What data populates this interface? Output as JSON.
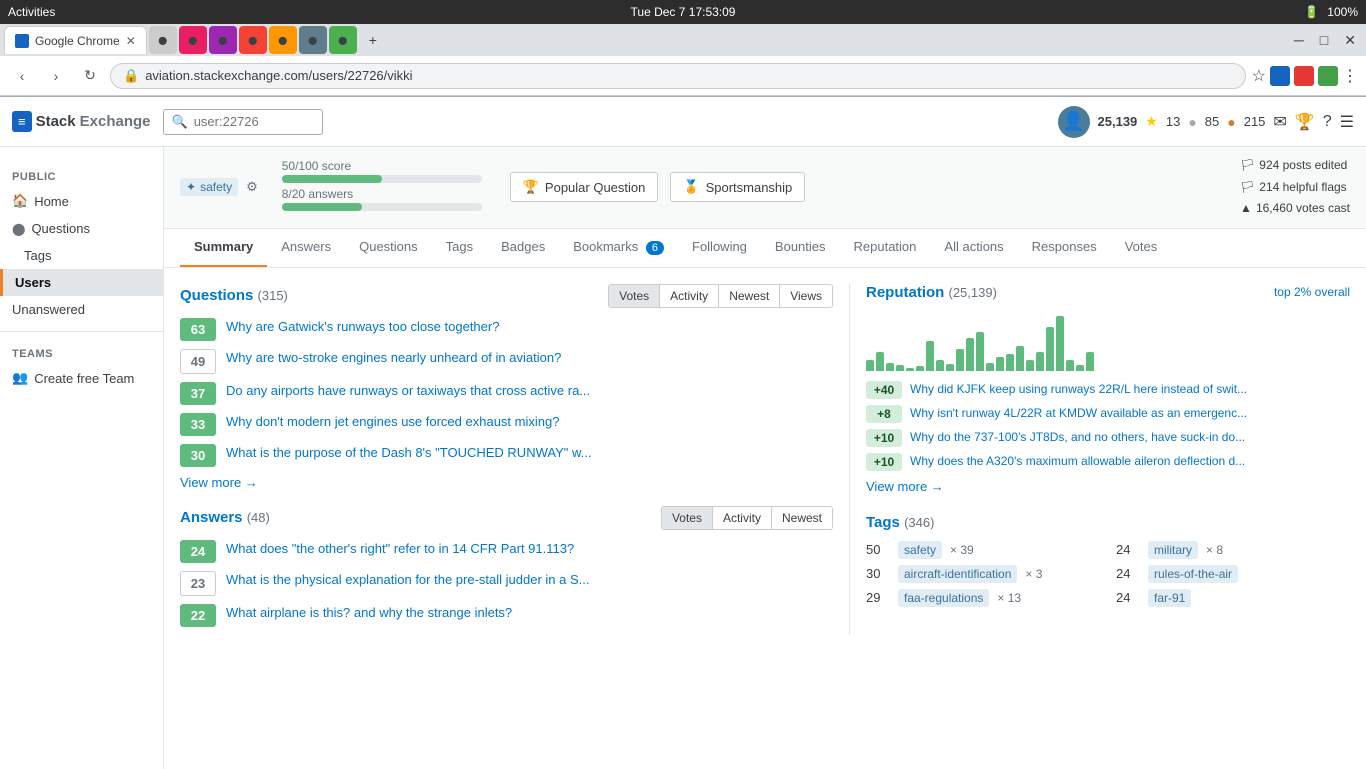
{
  "os_bar": {
    "left": "Activities",
    "browser": "Google Chrome",
    "center": "Tue Dec 7  17:53:09",
    "right_items": [
      "100%"
    ]
  },
  "address_bar": {
    "url": "aviation.stackexchange.com/users/22726/vikki"
  },
  "se_nav": {
    "logo_stack": "Stack",
    "logo_exchange": "Exchange",
    "search_placeholder": "user:22726",
    "reputation": "25,139",
    "gold": "13",
    "silver": "85",
    "bronze": "215"
  },
  "sidebar": {
    "public_label": "PUBLIC",
    "items": [
      {
        "label": "Home",
        "icon": "🏠",
        "active": false
      },
      {
        "label": "Questions",
        "icon": "❓",
        "active": false
      },
      {
        "label": "Tags",
        "icon": "🏷",
        "active": false
      },
      {
        "label": "Users",
        "icon": "👤",
        "active": true
      },
      {
        "label": "Unanswered",
        "icon": "?",
        "active": false
      }
    ],
    "teams_label": "TEAMS",
    "teams_item": "Create free Team"
  },
  "profile": {
    "tag": "safety",
    "score_label": "50/100 score",
    "score_pct": 50,
    "answers_label": "8/20 answers",
    "answers_pct": 40,
    "badges": [
      {
        "icon": "🏆",
        "label": "Popular Question"
      },
      {
        "icon": "🏅",
        "label": "Sportsmanship"
      }
    ],
    "stats": [
      "924 posts edited",
      "214 helpful flags",
      "16,460 votes cast"
    ]
  },
  "tabs": [
    {
      "label": "Summary",
      "active": true
    },
    {
      "label": "Answers"
    },
    {
      "label": "Questions"
    },
    {
      "label": "Tags"
    },
    {
      "label": "Badges"
    },
    {
      "label": "Bookmarks",
      "count": "6"
    },
    {
      "label": "Following"
    },
    {
      "label": "Bounties"
    },
    {
      "label": "Reputation"
    },
    {
      "label": "All actions"
    },
    {
      "label": "Responses"
    },
    {
      "label": "Votes"
    }
  ],
  "questions_section": {
    "title": "Questions",
    "count": "(315)",
    "view_tabs": [
      "Votes",
      "Activity",
      "Newest",
      "Views"
    ],
    "active_view": "Votes",
    "items": [
      {
        "votes": 63,
        "answered": true,
        "text": "Why are Gatwick's runways too close together?"
      },
      {
        "votes": 49,
        "answered": false,
        "text": "Why are two-stroke engines nearly unheard of in aviation?"
      },
      {
        "votes": 37,
        "answered": true,
        "text": "Do any airports have runways or taxiways that cross active ra..."
      },
      {
        "votes": 33,
        "answered": true,
        "text": "Why don't modern jet engines use forced exhaust mixing?"
      },
      {
        "votes": 30,
        "answered": true,
        "text": "What is the purpose of the Dash 8's \"TOUCHED RUNWAY\" w..."
      }
    ],
    "view_more": "View more →"
  },
  "reputation_section": {
    "title": "Reputation",
    "count": "(25,139)",
    "top_pct": "top 2% overall",
    "bars": [
      20,
      35,
      15,
      10,
      5,
      8,
      55,
      20,
      12,
      40,
      60,
      70,
      15,
      25,
      30,
      45,
      20,
      35,
      80,
      100,
      20,
      10,
      35
    ],
    "items": [
      {
        "score": "+40",
        "text": "Why did KJFK keep using runways 22R/L here instead of swit..."
      },
      {
        "score": "+8",
        "text": "Why isn't runway 4L/22R at KMDW available as an emergenc..."
      },
      {
        "score": "+10",
        "text": "Why do the 737-100's JT8Ds, and no others, have suck-in do..."
      },
      {
        "score": "+10",
        "text": "Why does the A320's maximum allowable aileron deflection d..."
      }
    ],
    "view_more": "View more →"
  },
  "answers_section": {
    "title": "Answers",
    "count": "(48)",
    "view_tabs": [
      "Votes",
      "Activity",
      "Newest"
    ],
    "active_view": "Votes",
    "items": [
      {
        "votes": 24,
        "answered": true,
        "text": "What does \"the other's right\" refer to in 14 CFR Part 91.113?"
      },
      {
        "votes": 23,
        "answered": false,
        "text": "What is the physical explanation for the pre-stall judder in a S..."
      },
      {
        "votes": 22,
        "answered": true,
        "text": "What airplane is this? and why the strange inlets?"
      }
    ]
  },
  "tags_section": {
    "title": "Tags",
    "count": "(346)",
    "items": [
      {
        "count": 50,
        "tag": "safety",
        "x": "× 39"
      },
      {
        "count": 24,
        "tag": "military",
        "x": "× 8"
      },
      {
        "count": 30,
        "tag": "aircraft-identification",
        "x": "× 3"
      },
      {
        "count": 24,
        "tag": "rules-of-the-air",
        "x": ""
      },
      {
        "count": 29,
        "tag": "faa-regulations",
        "x": "× 13"
      },
      {
        "count": 24,
        "tag": "far-91",
        "x": ""
      }
    ]
  }
}
